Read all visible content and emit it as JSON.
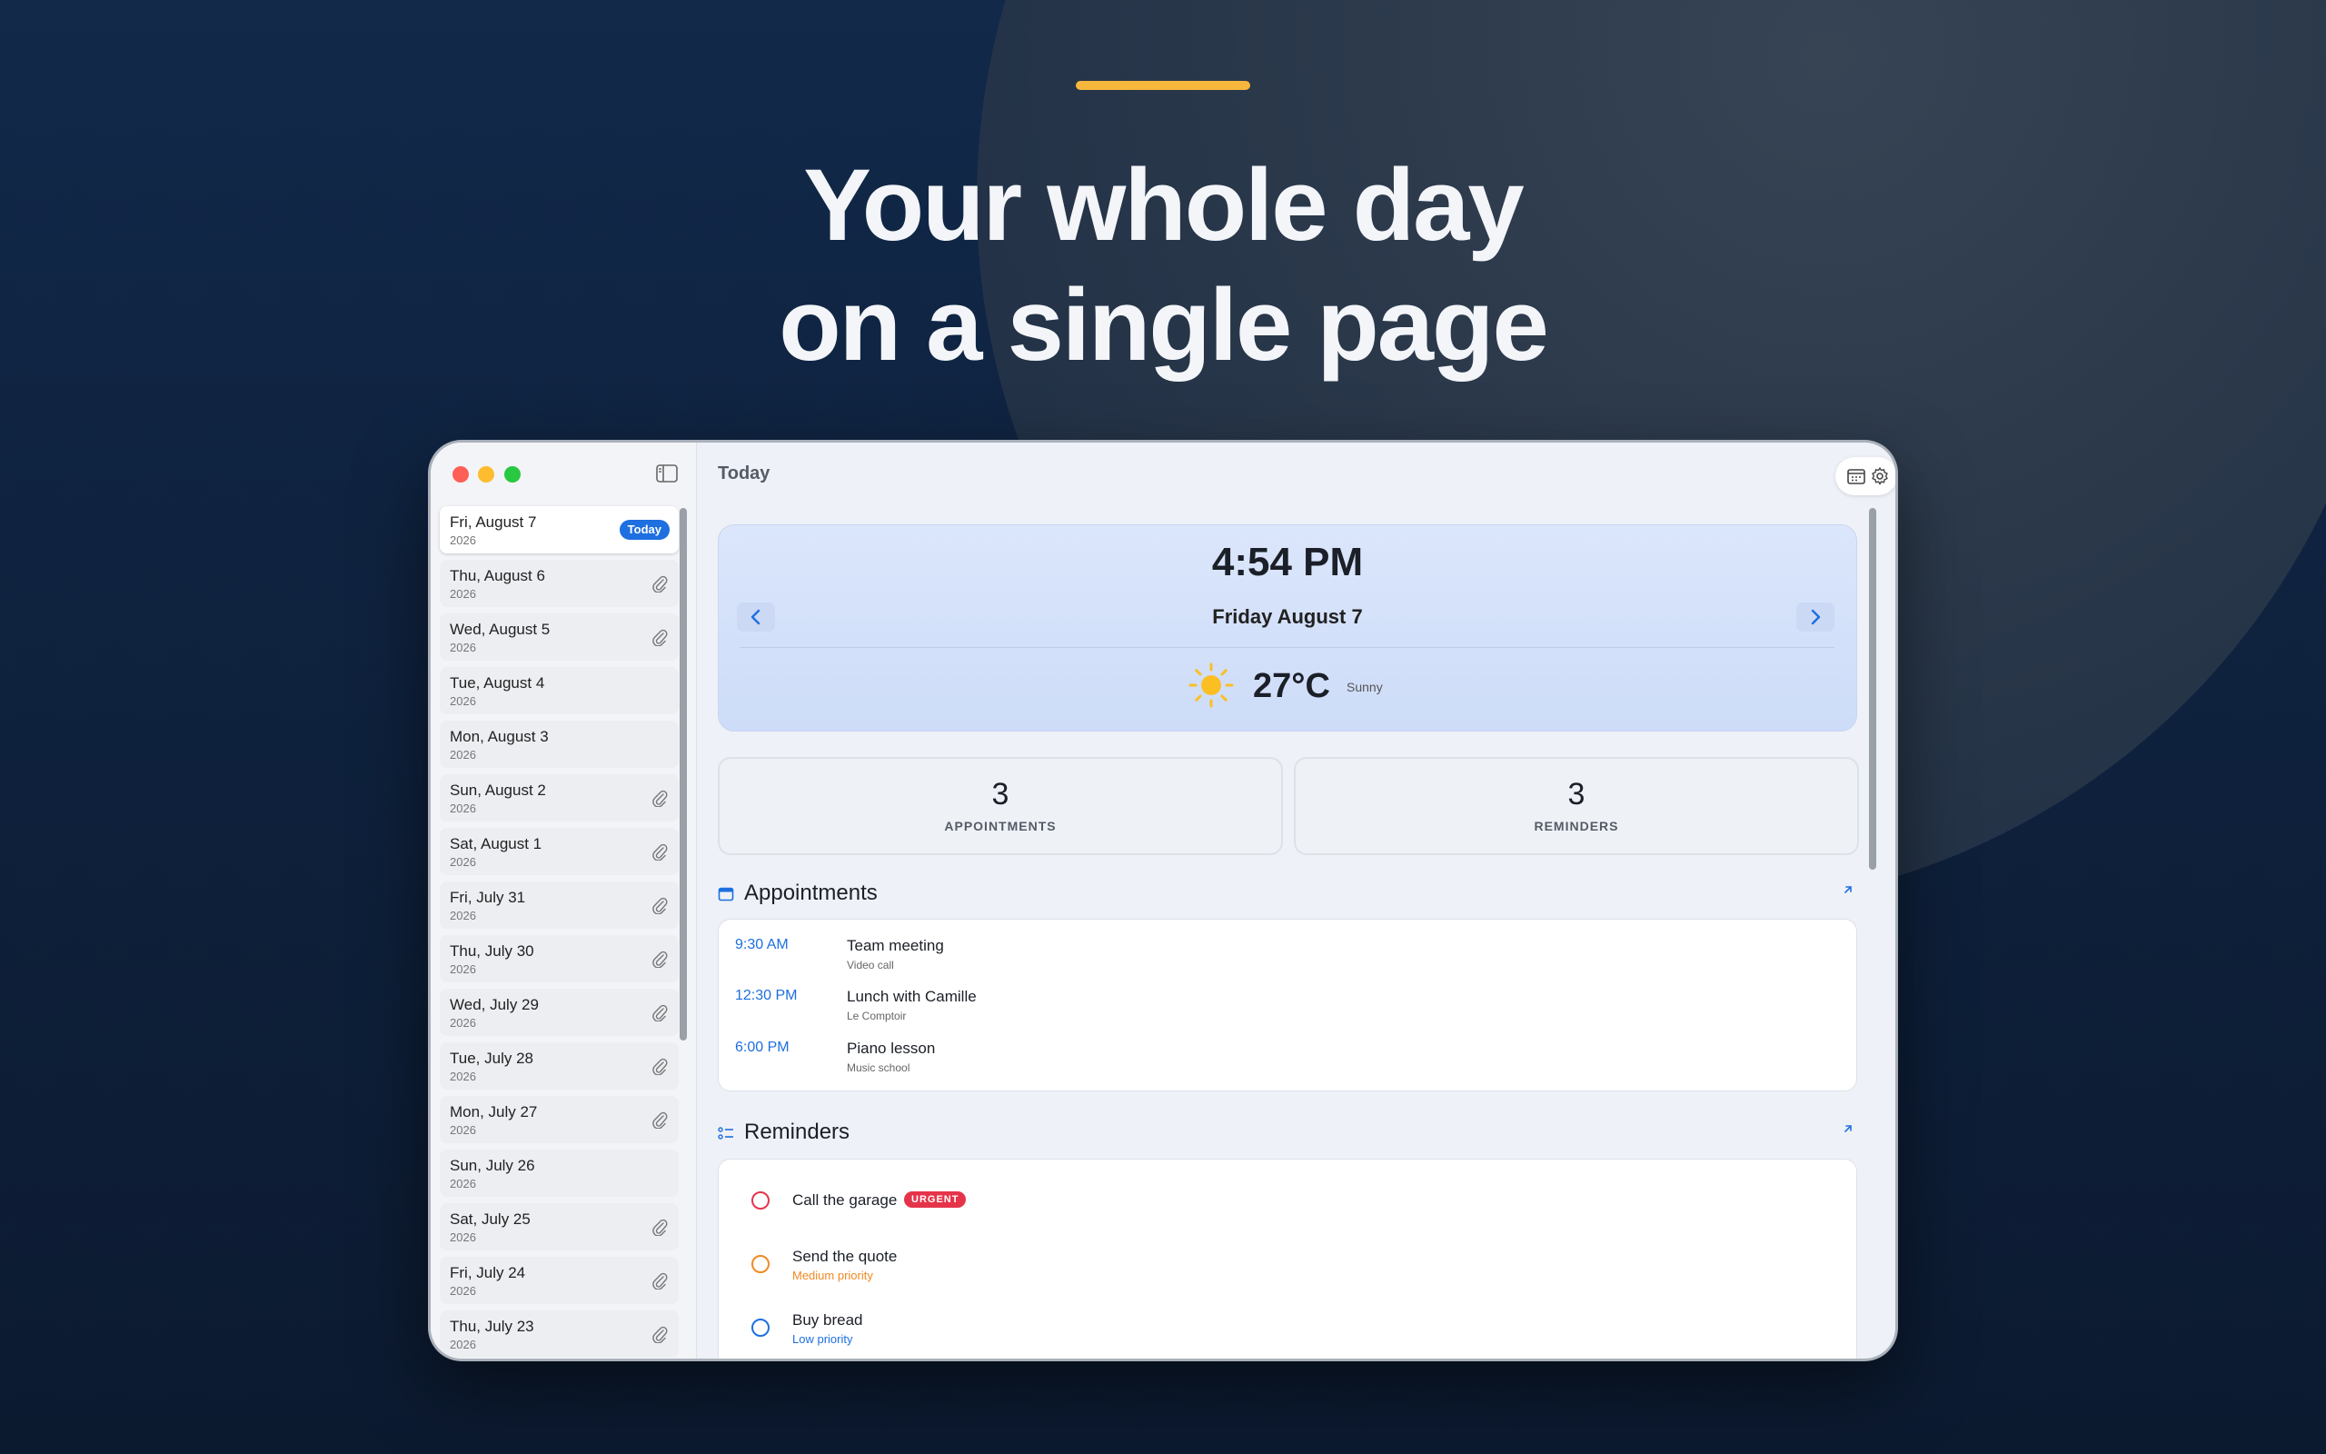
{
  "marketing": {
    "headline_line1": "Your whole day",
    "headline_line2": "on a single page"
  },
  "colors": {
    "accent": "#f6b73c",
    "primary_blue": "#1e6fe0",
    "urgent": "#e5344a",
    "medium_priority": "#f08a24",
    "low_priority": "#1e6fe0"
  },
  "sidebar": {
    "days": [
      {
        "day": "Fri, August 7",
        "year": "2026",
        "badge": "Today",
        "attachment": false,
        "selected": true
      },
      {
        "day": "Thu, August 6",
        "year": "2026",
        "attachment": true
      },
      {
        "day": "Wed, August 5",
        "year": "2026",
        "attachment": true
      },
      {
        "day": "Tue, August 4",
        "year": "2026",
        "attachment": false
      },
      {
        "day": "Mon, August 3",
        "year": "2026",
        "attachment": false
      },
      {
        "day": "Sun, August 2",
        "year": "2026",
        "attachment": true
      },
      {
        "day": "Sat, August 1",
        "year": "2026",
        "attachment": true
      },
      {
        "day": "Fri, July 31",
        "year": "2026",
        "attachment": true
      },
      {
        "day": "Thu, July 30",
        "year": "2026",
        "attachment": true
      },
      {
        "day": "Wed, July 29",
        "year": "2026",
        "attachment": true
      },
      {
        "day": "Tue, July 28",
        "year": "2026",
        "attachment": true
      },
      {
        "day": "Mon, July 27",
        "year": "2026",
        "attachment": true
      },
      {
        "day": "Sun, July 26",
        "year": "2026",
        "attachment": false
      },
      {
        "day": "Sat, July 25",
        "year": "2026",
        "attachment": true
      },
      {
        "day": "Fri, July 24",
        "year": "2026",
        "attachment": true
      },
      {
        "day": "Thu, July 23",
        "year": "2026",
        "attachment": true
      }
    ]
  },
  "main": {
    "title": "Today",
    "hero": {
      "time": "4:54 PM",
      "date": "Friday August 7",
      "temperature": "27°C",
      "condition": "Sunny",
      "weather_icon": "sun-icon"
    },
    "stats": [
      {
        "value": "3",
        "label": "APPOINTMENTS"
      },
      {
        "value": "3",
        "label": "REMINDERS"
      }
    ],
    "appointments": {
      "title": "Appointments",
      "items": [
        {
          "time": "9:30 AM",
          "title": "Team meeting",
          "subtitle": "Video call"
        },
        {
          "time": "12:30 PM",
          "title": "Lunch with Camille",
          "subtitle": "Le Comptoir"
        },
        {
          "time": "6:00 PM",
          "title": "Piano lesson",
          "subtitle": "Music school"
        }
      ]
    },
    "reminders": {
      "title": "Reminders",
      "items": [
        {
          "title": "Call the garage",
          "badge": "URGENT",
          "subtitle": "",
          "color": "#e5344a"
        },
        {
          "title": "Send the quote",
          "subtitle": "Medium priority",
          "color": "#f08a24"
        },
        {
          "title": "Buy bread",
          "subtitle": "Low priority",
          "color": "#1e6fe0"
        }
      ]
    }
  }
}
